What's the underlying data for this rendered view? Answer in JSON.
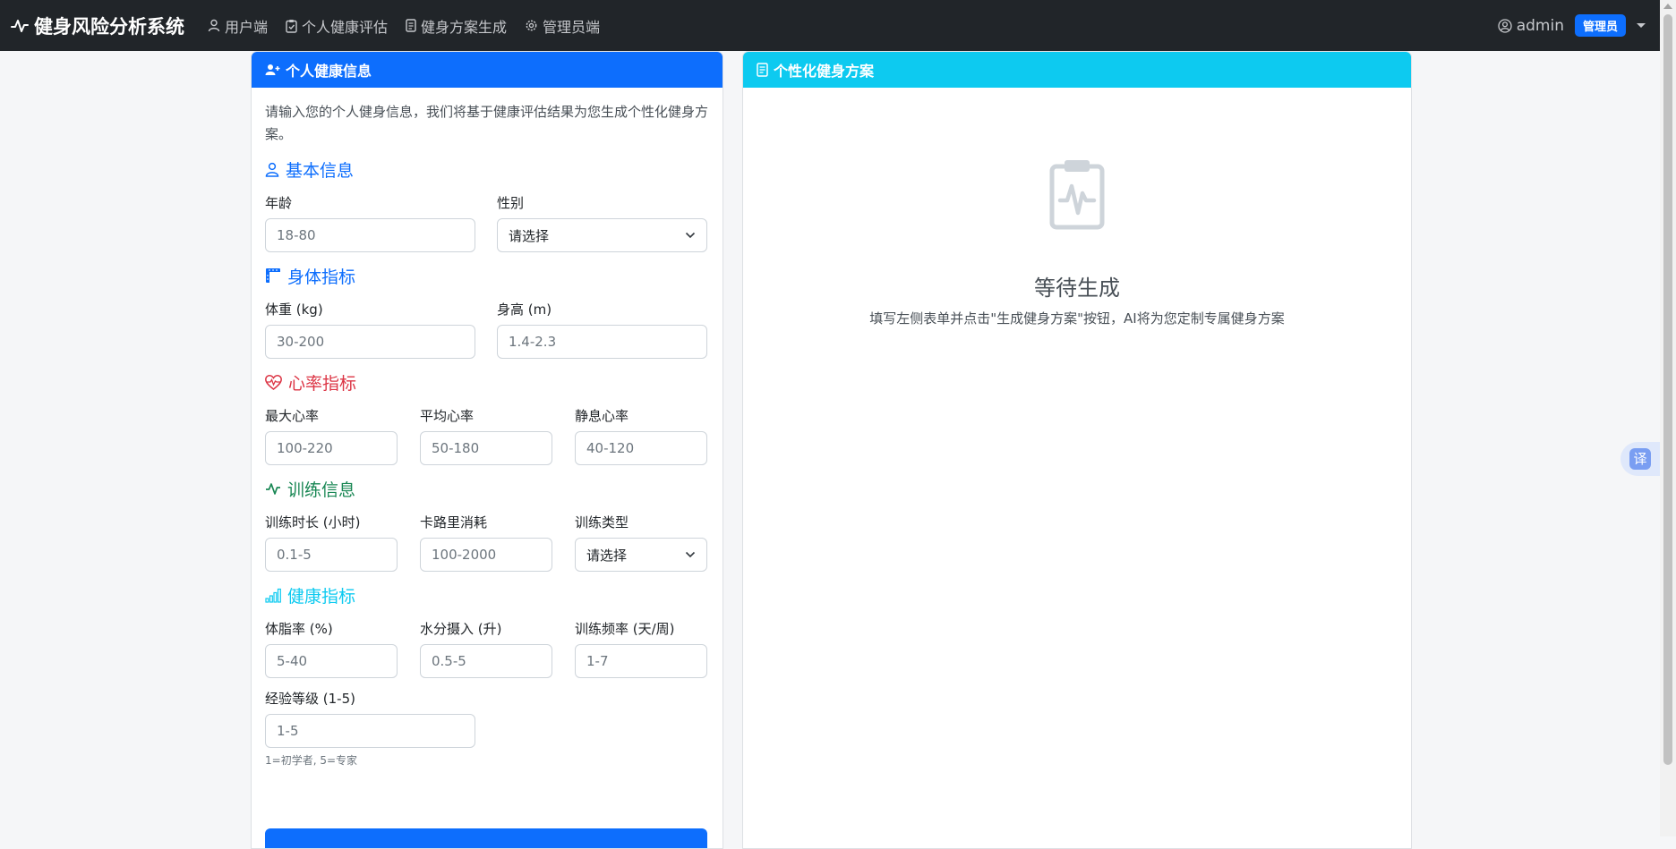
{
  "navbar": {
    "brand": "健身风险分析系统",
    "links": [
      "用户端",
      "个人健康评估",
      "健身方案生成",
      "管理员端"
    ],
    "user": "admin",
    "role_badge": "管理员"
  },
  "translate_label": "译",
  "left_card": {
    "header": "个人健康信息",
    "intro": "请输入您的个人健身信息，我们将基于健康评估结果为您生成个性化健身方案。",
    "sections": {
      "basic": {
        "title": "基本信息",
        "age_label": "年龄",
        "age_placeholder": "18-80",
        "gender_label": "性别",
        "gender_value": "请选择"
      },
      "body": {
        "title": "身体指标",
        "weight_label": "体重 (kg)",
        "weight_placeholder": "30-200",
        "height_label": "身高 (m)",
        "height_placeholder": "1.4-2.3"
      },
      "heart": {
        "title": "心率指标",
        "max_label": "最大心率",
        "max_placeholder": "100-220",
        "avg_label": "平均心率",
        "avg_placeholder": "50-180",
        "rest_label": "静息心率",
        "rest_placeholder": "40-120"
      },
      "training": {
        "title": "训练信息",
        "duration_label": "训练时长 (小时)",
        "duration_placeholder": "0.1-5",
        "calories_label": "卡路里消耗",
        "calories_placeholder": "100-2000",
        "type_label": "训练类型",
        "type_value": "请选择"
      },
      "health": {
        "title": "健康指标",
        "fat_label": "体脂率 (%)",
        "fat_placeholder": "5-40",
        "water_label": "水分摄入 (升)",
        "water_placeholder": "0.5-5",
        "freq_label": "训练频率 (天/周)",
        "freq_placeholder": "1-7",
        "exp_label": "经验等级 (1-5)",
        "exp_placeholder": "1-5",
        "exp_hint": "1=初学者, 5=专家"
      }
    }
  },
  "right_card": {
    "header": "个性化健身方案",
    "empty_title": "等待生成",
    "empty_desc": "填写左侧表单并点击\"生成健身方案\"按钮，AI将为您定制专属健身方案"
  },
  "colors": {
    "navbar": "#212529",
    "primary": "#0d6efd",
    "info": "#0dcaf0",
    "danger": "#dc3545",
    "success": "#198754"
  },
  "icons": {
    "brand": "activity-icon",
    "nav": [
      "person-icon",
      "clipboard-icon",
      "document-icon",
      "gear-icon"
    ],
    "user": "person-circle-icon",
    "sections": [
      "person-icon",
      "ruler-icon",
      "heart-pulse-icon",
      "activity-icon",
      "bar-chart-icon"
    ],
    "empty": "clipboard-pulse-icon"
  }
}
